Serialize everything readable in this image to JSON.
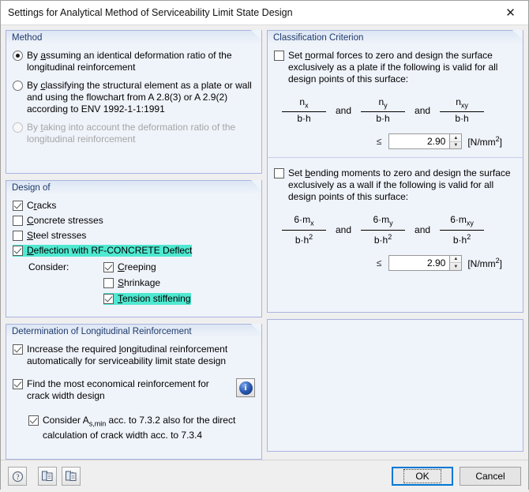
{
  "window": {
    "title": "Settings for Analytical Method of Serviceability Limit State Design",
    "close_icon": "close-icon"
  },
  "method": {
    "header": "Method",
    "options": [
      {
        "label_pre": "By ",
        "accel": "a",
        "label_post": "ssuming an identical deformation ratio of the longitudinal reinforcement",
        "selected": true,
        "disabled": false
      },
      {
        "label_pre": "By ",
        "accel": "c",
        "label_post": "lassifying the structural element as a plate or wall and using the flowchart from A 2.8(3) or A 2.9(2) according to ENV 1992-1-1:1991",
        "selected": false,
        "disabled": false
      },
      {
        "label_pre": "By ",
        "accel": "t",
        "label_post": "aking into account the deformation ratio of the longitudinal reinforcement",
        "selected": false,
        "disabled": true
      }
    ]
  },
  "design_of": {
    "header": "Design of",
    "items": [
      {
        "label_pre": "C",
        "accel": "r",
        "label_post": "acks",
        "checked": true,
        "highlighted": false
      },
      {
        "label_pre": "",
        "accel": "C",
        "label_post": "oncrete stresses",
        "checked": false,
        "highlighted": false
      },
      {
        "label_pre": "",
        "accel": "S",
        "label_post": "teel stresses",
        "checked": false,
        "highlighted": false
      },
      {
        "label_pre": "",
        "accel": "D",
        "label_post": "eflection with RF-CONCRETE Deflect",
        "checked": true,
        "highlighted": true
      }
    ],
    "consider_label": "Consider:",
    "consider_items": [
      {
        "label_pre": "",
        "accel": "C",
        "label_post": "reeping",
        "checked": true,
        "highlighted": false
      },
      {
        "label_pre": "",
        "accel": "S",
        "label_post": "hrinkage",
        "checked": false,
        "highlighted": false
      },
      {
        "label_pre": "",
        "accel": "T",
        "label_post": "ension stiffening",
        "checked": true,
        "highlighted": true
      }
    ]
  },
  "determination": {
    "header": "Determination of Longitudinal Reinforcement",
    "items": [
      {
        "label_pre": "Increase the required ",
        "accel": "l",
        "label_post": "ongitudinal reinforcement automatically for serviceability limit state design",
        "checked": true
      },
      {
        "label_pre": "Find the most economical reinforcement for crack width design",
        "accel": "",
        "label_post": "",
        "checked": true
      }
    ],
    "nested_item": {
      "text_before": "Consider A",
      "subscript": "s,min",
      "text_after": " acc. to 7.3.2 also for the direct calculation of crack width acc. to 7.3.4",
      "checked": true
    },
    "info_icon": "info-icon",
    "info_glyph": "i"
  },
  "classification": {
    "header": "Classification Criterion",
    "block1": {
      "label_pre": "Set ",
      "accel": "n",
      "label_post": "ormal forces to zero and design the surface exclusively as a plate if the following is valid for all design points of this surface:",
      "checked": false,
      "fractions": [
        {
          "num_base": "n",
          "num_sub": "x",
          "den_base": "b·h",
          "den_sup": ""
        },
        {
          "num_base": "n",
          "num_sub": "y",
          "den_base": "b·h",
          "den_sup": ""
        },
        {
          "num_base": "n",
          "num_sub": "xy",
          "den_base": "b·h",
          "den_sup": ""
        }
      ],
      "and_label": "and",
      "operator": "≤",
      "value": "2.90",
      "unit_base": "[N/mm",
      "unit_sup": "2",
      "unit_end": "]"
    },
    "block2": {
      "label_pre": "Set ",
      "accel": "b",
      "label_post": "ending moments to zero and design the surface exclusively as a wall if the following is valid for all design points of this surface:",
      "checked": false,
      "fractions": [
        {
          "num_base": "6·m",
          "num_sub": "x",
          "den_base": "b·h",
          "den_sup": "2"
        },
        {
          "num_base": "6·m",
          "num_sub": "y",
          "den_base": "b·h",
          "den_sup": "2"
        },
        {
          "num_base": "6·m",
          "num_sub": "xy",
          "den_base": "b·h",
          "den_sup": "2"
        }
      ],
      "and_label": "and",
      "operator": "≤",
      "value": "2.90",
      "unit_base": "[N/mm",
      "unit_sup": "2",
      "unit_end": "]"
    }
  },
  "footer": {
    "tools": [
      {
        "icon": "help-icon",
        "name": "help-button"
      },
      {
        "icon": "document-copy-icon",
        "name": "load-settings-button"
      },
      {
        "icon": "document-save-icon",
        "name": "save-settings-button"
      }
    ],
    "ok_label": "OK",
    "cancel_label": "Cancel"
  },
  "colors": {
    "highlight": "#4fe8d0",
    "group_border": "#aab4e0",
    "group_bg": "#eff3fa",
    "header_text": "#1e3a6b",
    "focus_blue": "#0078d7"
  }
}
